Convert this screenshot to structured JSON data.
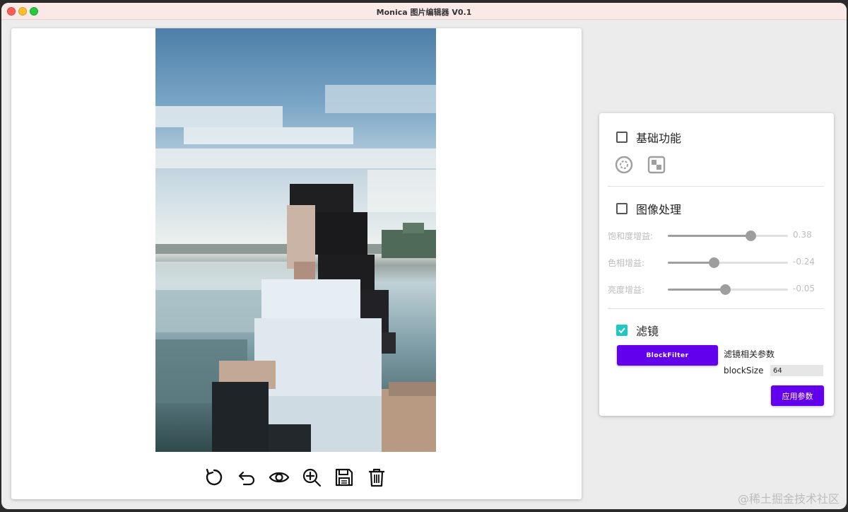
{
  "window": {
    "title": "Monica 图片编辑器 V0.1"
  },
  "toolbar": {
    "tools": [
      "rotate-icon",
      "undo-icon",
      "preview-eye-icon",
      "zoom-in-icon",
      "save-icon",
      "delete-icon"
    ]
  },
  "panel": {
    "basic": {
      "label": "基础功能",
      "checked": false
    },
    "image_processing": {
      "label": "图像处理",
      "checked": false,
      "sliders": [
        {
          "label": "饱和度增益:",
          "value": "0.38",
          "fraction": 0.69
        },
        {
          "label": "色相增益:",
          "value": "-0.24",
          "fraction": 0.38
        },
        {
          "label": "亮度增益:",
          "value": "-0.05",
          "fraction": 0.475
        }
      ]
    },
    "filter": {
      "label": "滤镜",
      "checked": true,
      "button_label": "BlockFilter",
      "params_title": "滤镜相关参数",
      "param_label": "blockSize",
      "param_value": "64",
      "apply_label": "应用参数"
    }
  },
  "watermark": "@稀土掘金技术社区",
  "colors": {
    "accent": "#6200ee",
    "checkbox": "#1fc8c2"
  }
}
